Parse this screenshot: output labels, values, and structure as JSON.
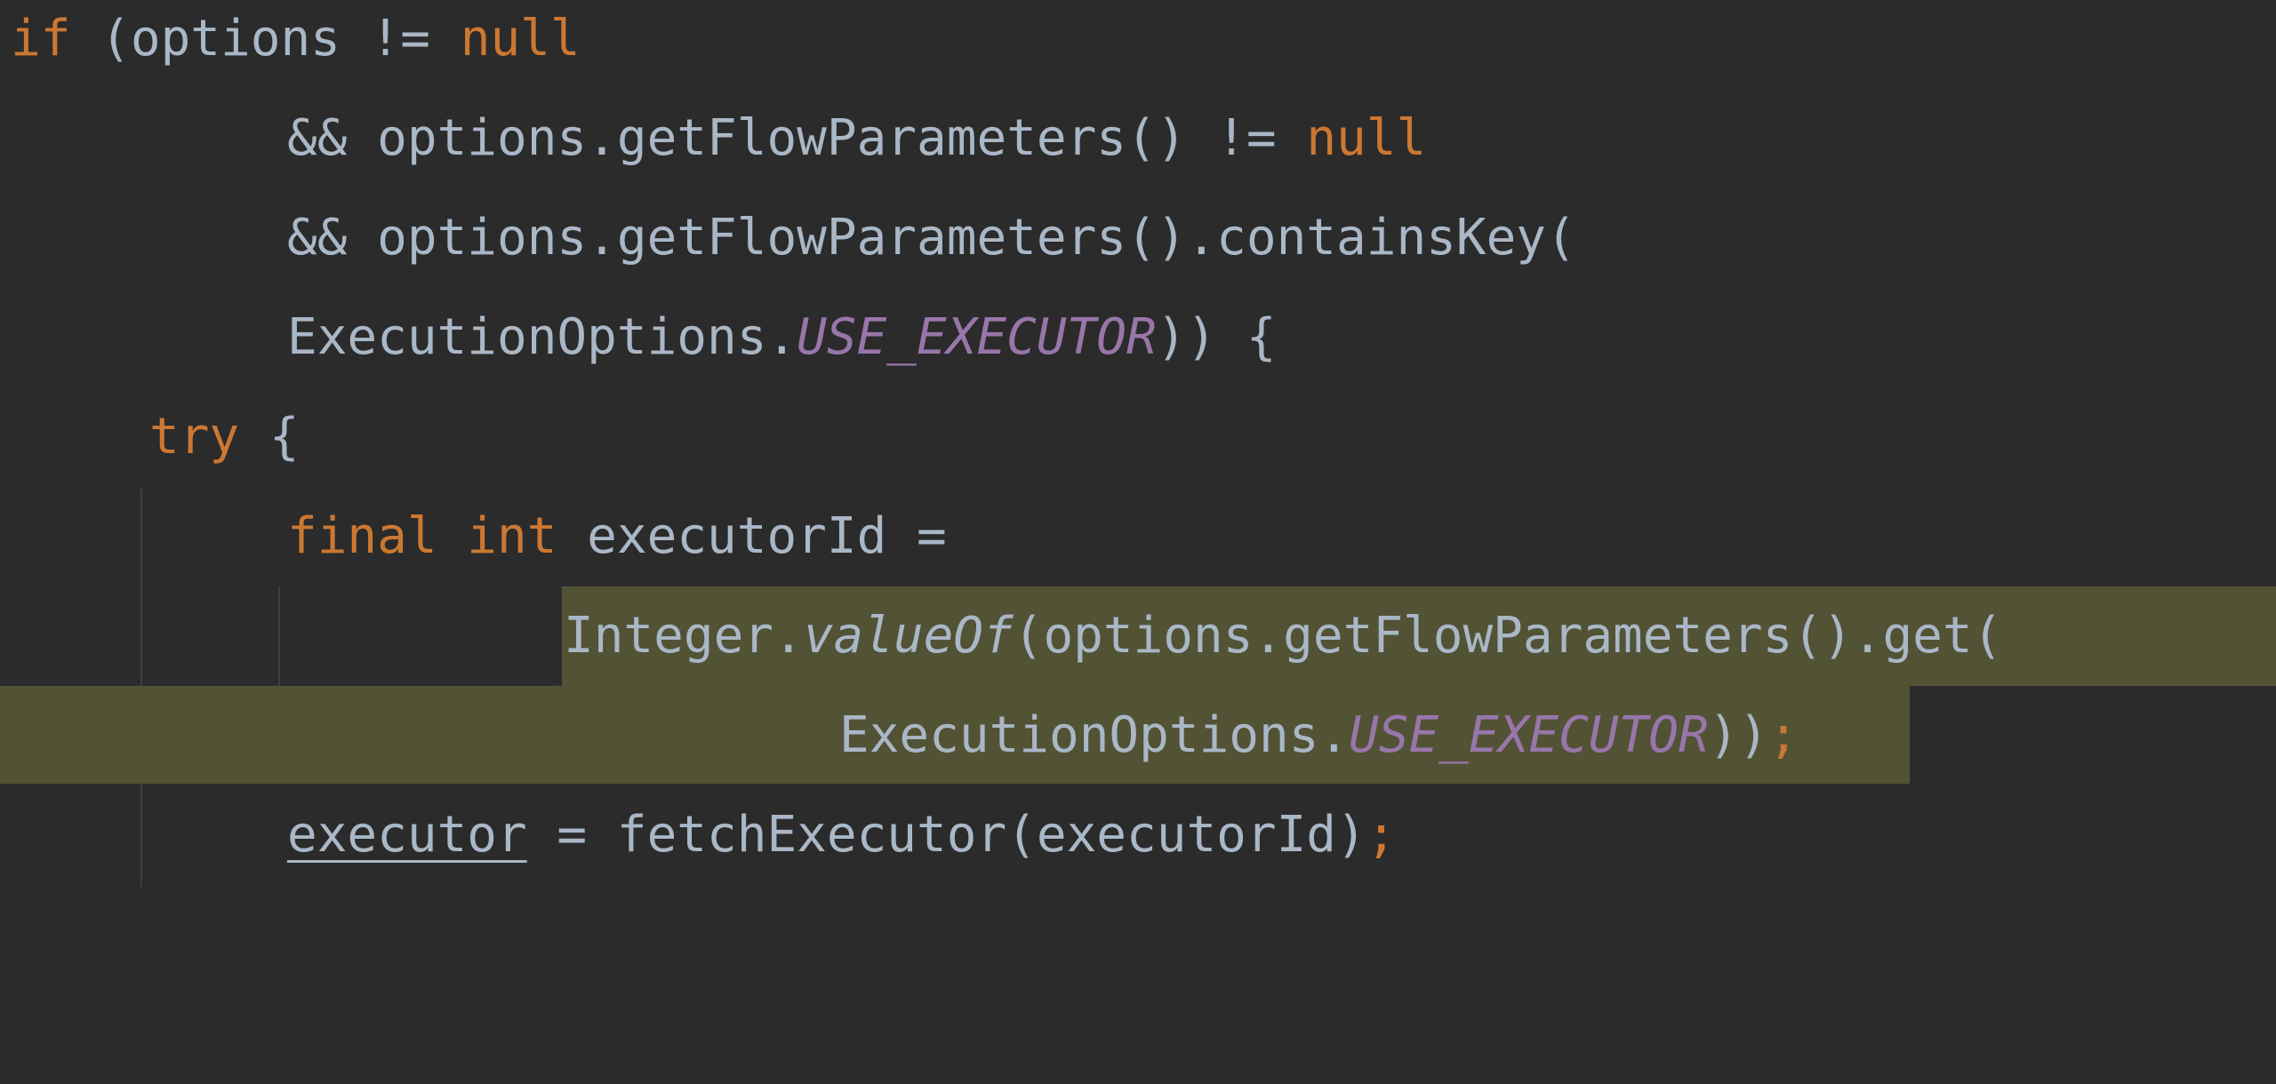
{
  "editor": {
    "lines": [
      {
        "tokens": [
          "if",
          " (options != ",
          "null"
        ]
      },
      {
        "tokens": [
          "&& options.getFlowParameters() != ",
          "null"
        ]
      },
      {
        "tokens": [
          "&& options.getFlowParameters().containsKey("
        ]
      },
      {
        "tokens": [
          "ExecutionOptions.",
          "USE_EXECUTOR",
          ")) {"
        ]
      },
      {
        "tokens": [
          "try",
          " {"
        ]
      },
      {
        "tokens": [
          "final",
          " ",
          "int",
          " executorId ="
        ]
      },
      {
        "tokens": [
          "Integer.",
          "valueOf",
          "(options.getFlowParameters().get("
        ]
      },
      {
        "tokens": [
          "ExecutionOptions.",
          "USE_EXECUTOR",
          "))",
          ";"
        ]
      },
      {
        "tokens": [
          "executor",
          " = fetchExecutor(executorId)",
          ";"
        ]
      }
    ]
  },
  "colors": {
    "background": "#2b2b2b",
    "keyword": "#cc7832",
    "constant": "#9876aa",
    "text": "#a9b7c6",
    "selection": "#525235"
  }
}
